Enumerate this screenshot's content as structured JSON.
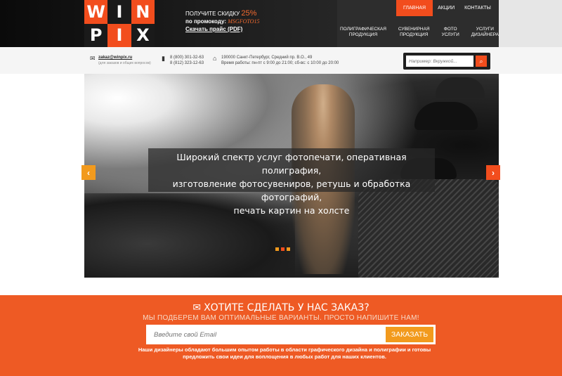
{
  "logo": {
    "letters": [
      "W",
      "I",
      "N",
      "P",
      "I",
      "X"
    ]
  },
  "promo": {
    "line1": "ПОЛУЧИТЕ СКИДКУ",
    "percent": "25%",
    "line2": "по промокоду:",
    "code": "MSGFOTO15",
    "price_link": "Скачать прайс (PDF)"
  },
  "topnav": {
    "items": [
      "ГЛАВНАЯ",
      "АКЦИИ",
      "КОНТАКТЫ"
    ],
    "active": "ГЛАВНАЯ"
  },
  "subnav": {
    "items": [
      [
        "ПОЛИГРАФИЧЕСКАЯ",
        "ПРОДУКЦИЯ"
      ],
      [
        "СУВЕНИРНАЯ",
        "ПРОДУКЦИЯ"
      ],
      [
        "ФОТО",
        "УСЛУГИ"
      ],
      [
        "УСЛУГИ",
        "ДИЗАЙНЕРА"
      ]
    ]
  },
  "contacts": {
    "email": "zakaz@winpix.ru",
    "email_note": "(для заказов и общих вопросов)",
    "phone1": "8 (800) 301-32-63",
    "phone2": "8 (812) 323-12-63",
    "address": "190000 Санкт-Петербург, Средний пр. В.О., 49",
    "hours": "Время работы: пн-пт с 9:00 до 21:00; сб-вс: с 10:00 до 20:00"
  },
  "search": {
    "placeholder": "Например: Вкружкой..."
  },
  "hero": {
    "caption_line1": "Широкий спектр услуг фотопечати, оперативная полиграфия,",
    "caption_line2": "изготовление фотосувениров,  ретушь и обработка фотографий,",
    "caption_line3": "печать картин на холсте",
    "slide_count": 3,
    "active_slide": 2
  },
  "order": {
    "title": "ХОТИТЕ СДЕЛАТЬ У НАС ЗАКАЗ?",
    "subtitle": "МЫ ПОДБЕРЕМ ВАМ ОПТИМАЛЬНЫЕ ВАРИАНТЫ. ПРОСТО НАПИШИТЕ НАМ!",
    "email_placeholder": "Введите свой Email",
    "submit_label": "ЗАКАЗАТЬ",
    "note_line1": "Наши дизайнеры обладают большим опытом работы в области графического дизайна и полиграфии и готовы",
    "note_line2": "предложить свои идеи для воплощения в любых работ для наших клиентов."
  },
  "colors": {
    "accent": "#f24d1d",
    "orange": "#f29a1d",
    "dark": "#1b1b1b",
    "order_bg": "#ee5a24"
  }
}
